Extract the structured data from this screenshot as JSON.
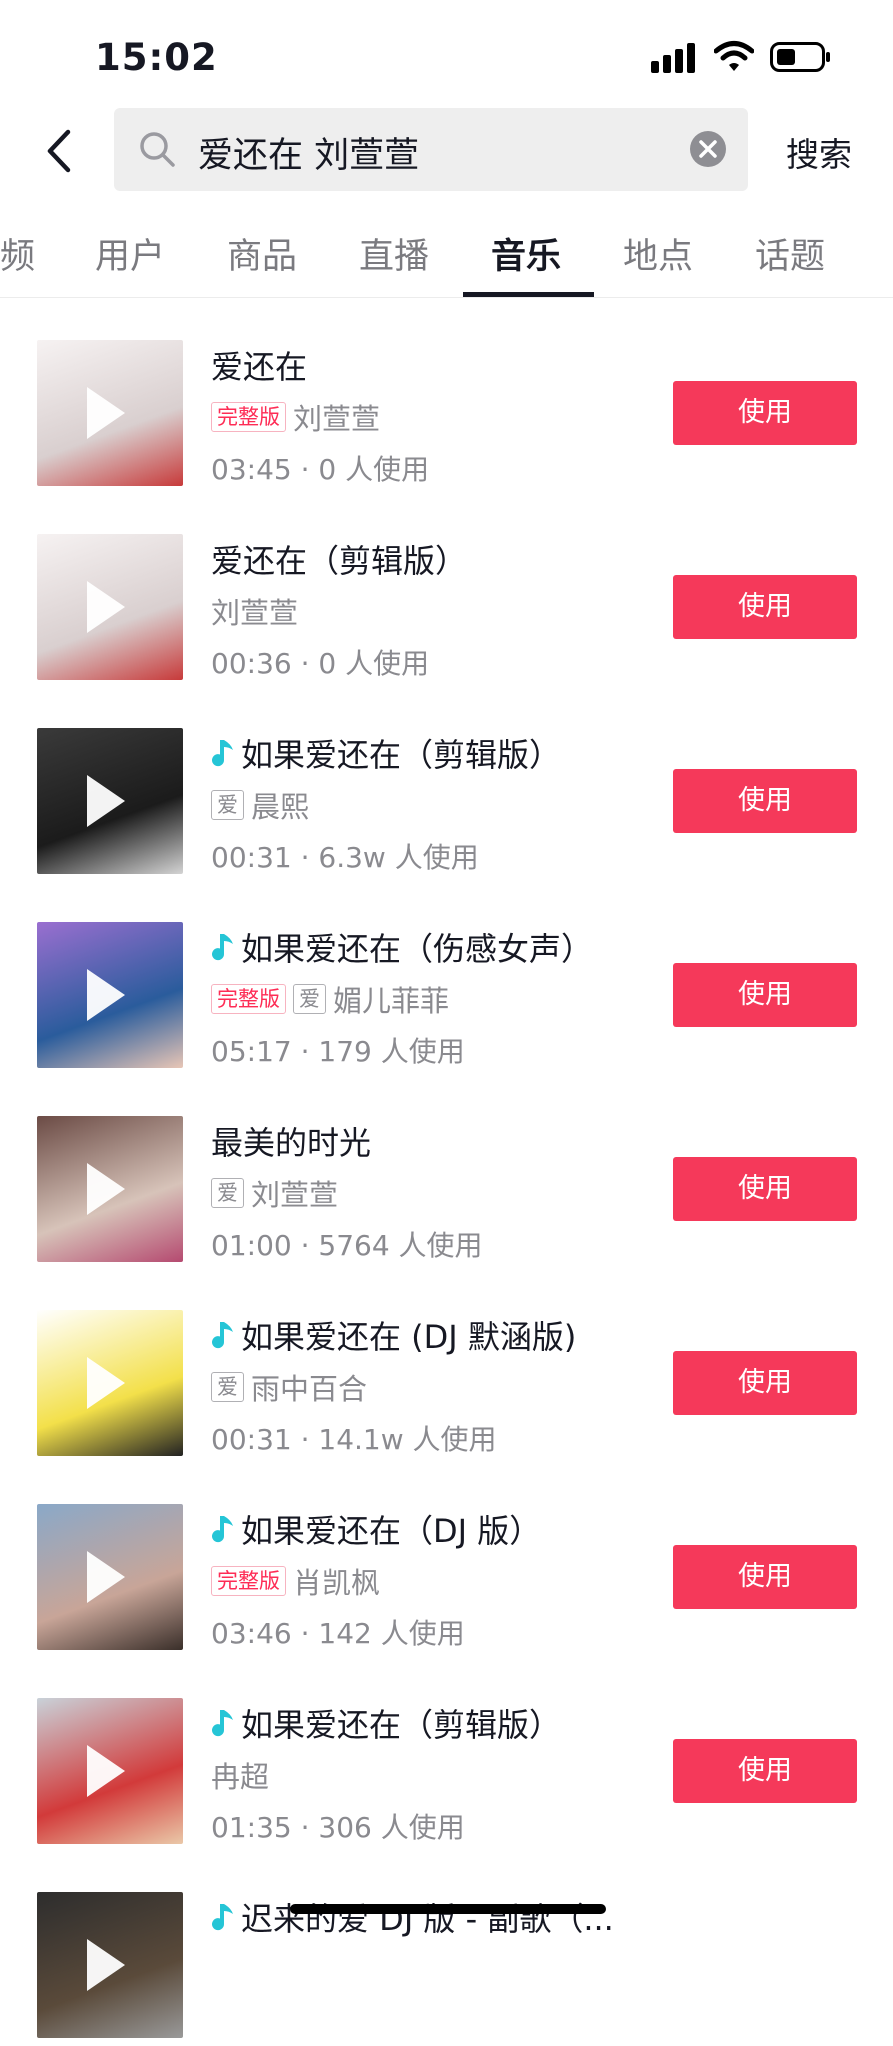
{
  "status_bar": {
    "time": "15:02"
  },
  "search": {
    "query": "爱还在 刘萱萱",
    "submit_label": "搜索"
  },
  "tabs": [
    {
      "label": "频",
      "active": false
    },
    {
      "label": "用户",
      "active": false
    },
    {
      "label": "商品",
      "active": false
    },
    {
      "label": "直播",
      "active": false
    },
    {
      "label": "音乐",
      "active": true
    },
    {
      "label": "地点",
      "active": false
    },
    {
      "label": "话题",
      "active": false
    }
  ],
  "use_label": "使用",
  "tags": {
    "full": "完整版",
    "love": "爱"
  },
  "music": [
    {
      "title": "爱还在",
      "has_note_icon": false,
      "full": true,
      "love": false,
      "artist": "刘萱萱",
      "stats": "03:45 · 0 人使用",
      "thumb_colors": [
        "#f6f2f2",
        "#d9cfcf",
        "#c73a3a"
      ]
    },
    {
      "title": "爱还在（剪辑版）",
      "has_note_icon": false,
      "full": false,
      "love": false,
      "artist": "刘萱萱",
      "stats": "00:36 · 0 人使用",
      "thumb_colors": [
        "#f6f2f2",
        "#d9cfcf",
        "#c73a3a"
      ]
    },
    {
      "title": "如果爱还在（剪辑版）",
      "has_note_icon": true,
      "full": false,
      "love": true,
      "artist": "晨熙",
      "stats": "00:31 · 6.3w 人使用",
      "thumb_colors": [
        "#3a3a3a",
        "#1b1b1b",
        "#d4d4d4"
      ]
    },
    {
      "title": "如果爱还在（伤感女声）",
      "has_note_icon": true,
      "full": true,
      "love": true,
      "artist": "媚儿菲菲",
      "stats": "05:17 · 179 人使用",
      "thumb_colors": [
        "#9a6fd0",
        "#2a5c9c",
        "#e8c6b6"
      ]
    },
    {
      "title": "最美的时光",
      "has_note_icon": false,
      "full": false,
      "love": true,
      "artist": "刘萱萱",
      "stats": "01:00 · 5764 人使用",
      "thumb_colors": [
        "#6b4b45",
        "#d7c3b9",
        "#b54a70"
      ]
    },
    {
      "title": "如果爱还在 (DJ 默涵版)",
      "has_note_icon": true,
      "full": false,
      "love": true,
      "artist": "雨中百合",
      "stats": "00:31 · 14.1w 人使用",
      "thumb_colors": [
        "#ffffff",
        "#f3e04a",
        "#222222"
      ]
    },
    {
      "title": "如果爱还在（DJ 版）",
      "has_note_icon": true,
      "full": true,
      "love": false,
      "artist": "肖凯枫",
      "stats": "03:46 · 142 人使用",
      "thumb_colors": [
        "#8aa8c8",
        "#c8a598",
        "#3a2f2a"
      ]
    },
    {
      "title": "如果爱还在（剪辑版）",
      "has_note_icon": true,
      "full": false,
      "love": false,
      "artist": "冉超",
      "stats": "01:35 · 306 人使用",
      "thumb_colors": [
        "#c9d2d9",
        "#d23a3a",
        "#eac8a8"
      ]
    },
    {
      "title": "迟来的爱 DJ 版 - 副歌（...",
      "has_note_icon": true,
      "full": false,
      "love": false,
      "artist": "",
      "stats": "",
      "thumb_colors": [
        "#2d2d2d",
        "#5a4a3a",
        "#999999"
      ]
    }
  ],
  "colors": {
    "accent": "#f5395a",
    "text": "#161823",
    "muted": "#8a8a8f",
    "note": "#25c5d6"
  }
}
